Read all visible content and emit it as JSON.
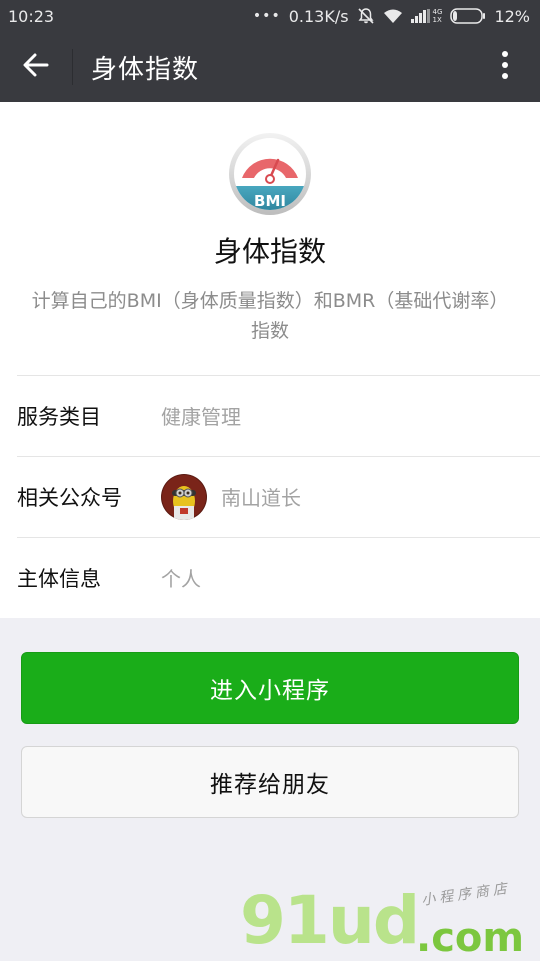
{
  "status_bar": {
    "time": "10:23",
    "dots": "•••",
    "speed": "0.13K/s",
    "network_4g": "4G",
    "network_1x": "1X",
    "battery": "12%"
  },
  "header": {
    "title": "身体指数"
  },
  "app": {
    "icon_text": "BMI",
    "name": "身体指数",
    "description": "计算自己的BMI（身体质量指数）和BMR（基础代谢率）指数"
  },
  "info": {
    "service_label": "服务类目",
    "service_value": "健康管理",
    "account_label": "相关公众号",
    "account_value": "南山道长",
    "subject_label": "主体信息",
    "subject_value": "个人"
  },
  "buttons": {
    "enter": "进入小程序",
    "recommend": "推荐给朋友"
  },
  "watermark": {
    "main": "91ud",
    "dotcom": ".com",
    "tag": "小程序商店"
  }
}
